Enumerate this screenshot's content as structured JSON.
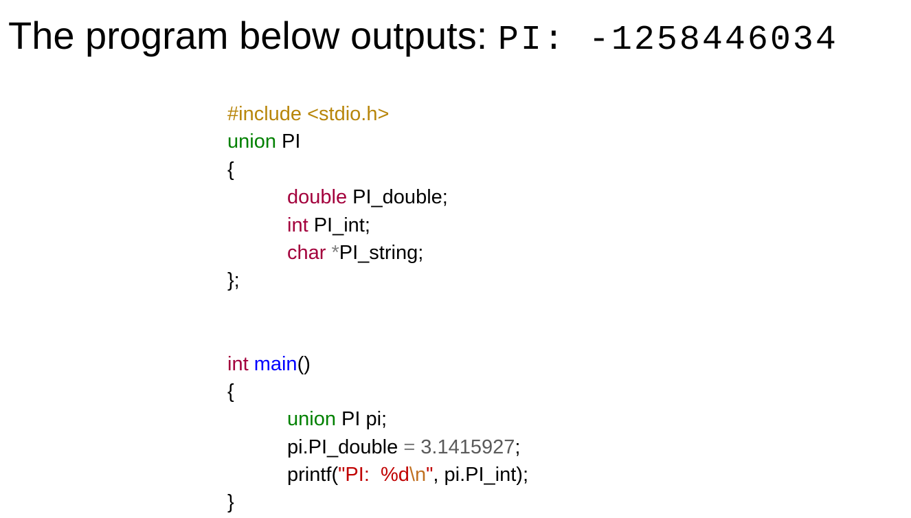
{
  "headline": {
    "text": "The program below outputs: ",
    "output": "PI:  -1258446034"
  },
  "code": {
    "include": "#include <stdio.h>",
    "union_keyword": "union",
    "union_name": " PI",
    "open_brace_1": "{",
    "field1_type": "double",
    "field1_rest": " PI_double;",
    "field2_type": "int",
    "field2_rest": " PI_int;",
    "field3_type": "char",
    "field3_star": " *",
    "field3_rest": "PI_string;",
    "close_union": "};",
    "main_type": "int",
    "main_name": " main",
    "main_parens": "()",
    "open_brace_2": "{",
    "stmt1_keyword": "union",
    "stmt1_rest": " PI pi;",
    "stmt2_lhs": "pi.PI_double ",
    "stmt2_op": "=",
    "stmt2_num": " 3.1415927",
    "stmt2_end": ";",
    "stmt3_call": "printf(",
    "stmt3_str": "\"PI:  %d",
    "stmt3_esc": "\\n",
    "stmt3_strend": "\"",
    "stmt3_rest": ", pi.PI_int);",
    "close_main": "}"
  }
}
